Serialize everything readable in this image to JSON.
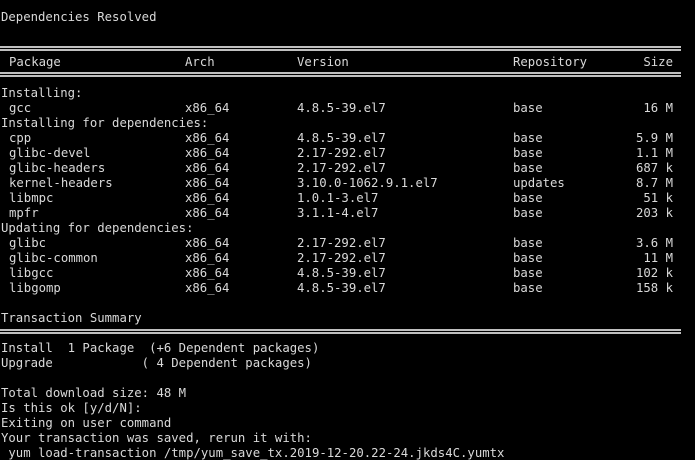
{
  "heading": "Dependencies Resolved",
  "columns": {
    "package": "Package",
    "arch": "Arch",
    "version": "Version",
    "repository": "Repository",
    "size": "Size"
  },
  "groups": [
    {
      "label": "Installing:",
      "rows": [
        {
          "package": "gcc",
          "arch": "x86_64",
          "version": "4.8.5-39.el7",
          "repository": "base",
          "size": "16 M"
        }
      ]
    },
    {
      "label": "Installing for dependencies:",
      "rows": [
        {
          "package": "cpp",
          "arch": "x86_64",
          "version": "4.8.5-39.el7",
          "repository": "base",
          "size": "5.9 M"
        },
        {
          "package": "glibc-devel",
          "arch": "x86_64",
          "version": "2.17-292.el7",
          "repository": "base",
          "size": "1.1 M"
        },
        {
          "package": "glibc-headers",
          "arch": "x86_64",
          "version": "2.17-292.el7",
          "repository": "base",
          "size": "687 k"
        },
        {
          "package": "kernel-headers",
          "arch": "x86_64",
          "version": "3.10.0-1062.9.1.el7",
          "repository": "updates",
          "size": "8.7 M"
        },
        {
          "package": "libmpc",
          "arch": "x86_64",
          "version": "1.0.1-3.el7",
          "repository": "base",
          "size": "51 k"
        },
        {
          "package": "mpfr",
          "arch": "x86_64",
          "version": "3.1.1-4.el7",
          "repository": "base",
          "size": "203 k"
        }
      ]
    },
    {
      "label": "Updating for dependencies:",
      "rows": [
        {
          "package": "glibc",
          "arch": "x86_64",
          "version": "2.17-292.el7",
          "repository": "base",
          "size": "3.6 M"
        },
        {
          "package": "glibc-common",
          "arch": "x86_64",
          "version": "2.17-292.el7",
          "repository": "base",
          "size": "11 M"
        },
        {
          "package": "libgcc",
          "arch": "x86_64",
          "version": "4.8.5-39.el7",
          "repository": "base",
          "size": "102 k"
        },
        {
          "package": "libgomp",
          "arch": "x86_64",
          "version": "4.8.5-39.el7",
          "repository": "base",
          "size": "158 k"
        }
      ]
    }
  ],
  "summary": {
    "title": "Transaction Summary",
    "install_line": "Install  1 Package  (+6 Dependent packages)",
    "upgrade_line": "Upgrade            ( 4 Dependent packages)"
  },
  "footer": {
    "download_size": "Total download size: 48 M",
    "prompt": "Is this ok [y/d/N]: ",
    "exiting": "Exiting on user command",
    "saved": "Your transaction was saved, rerun it with:",
    "command": " yum load-transaction /tmp/yum_save_tx.2019-12-20.22-24.jkds4C.yumtx"
  },
  "colors": {
    "background": "#000000",
    "text": "#d9d9d9",
    "rule": "#bfbfbf"
  }
}
